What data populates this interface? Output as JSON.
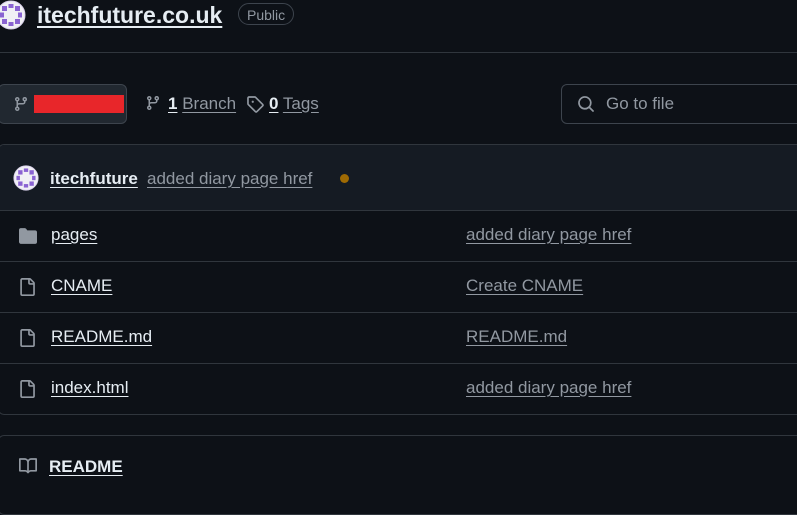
{
  "repo": {
    "name": "itechfuture.co.uk",
    "visibility": "Public",
    "avatar_icon": "identicon-avatar",
    "avatar_color": "#8a63d2"
  },
  "toolbar": {
    "branch_icon": "git-branch-icon",
    "branch_name_redacted_color": "#e8262a",
    "branches_count": "1",
    "branches_label": "Branch",
    "tags_count": "0",
    "tags_label": "Tags",
    "search": {
      "placeholder": "Go to file",
      "value": ""
    }
  },
  "latest_commit": {
    "author": "itechfuture",
    "message": "added diary page href",
    "status_color": "#9e6a03"
  },
  "files": [
    {
      "name": "pages",
      "type": "directory",
      "icon": "folder-icon",
      "commit_message": "added diary page href"
    },
    {
      "name": "CNAME",
      "type": "file",
      "icon": "file-icon",
      "commit_message": "Create CNAME"
    },
    {
      "name": "README.md",
      "type": "file",
      "icon": "file-icon",
      "commit_message": "README.md"
    },
    {
      "name": "index.html",
      "type": "file",
      "icon": "file-icon",
      "commit_message": "added diary page href"
    }
  ],
  "readme": {
    "icon": "book-icon",
    "tab_label": "README"
  },
  "colors": {
    "background": "#0d1117",
    "border": "#30363d",
    "text": "#e6edf3",
    "muted": "#9198a1"
  }
}
